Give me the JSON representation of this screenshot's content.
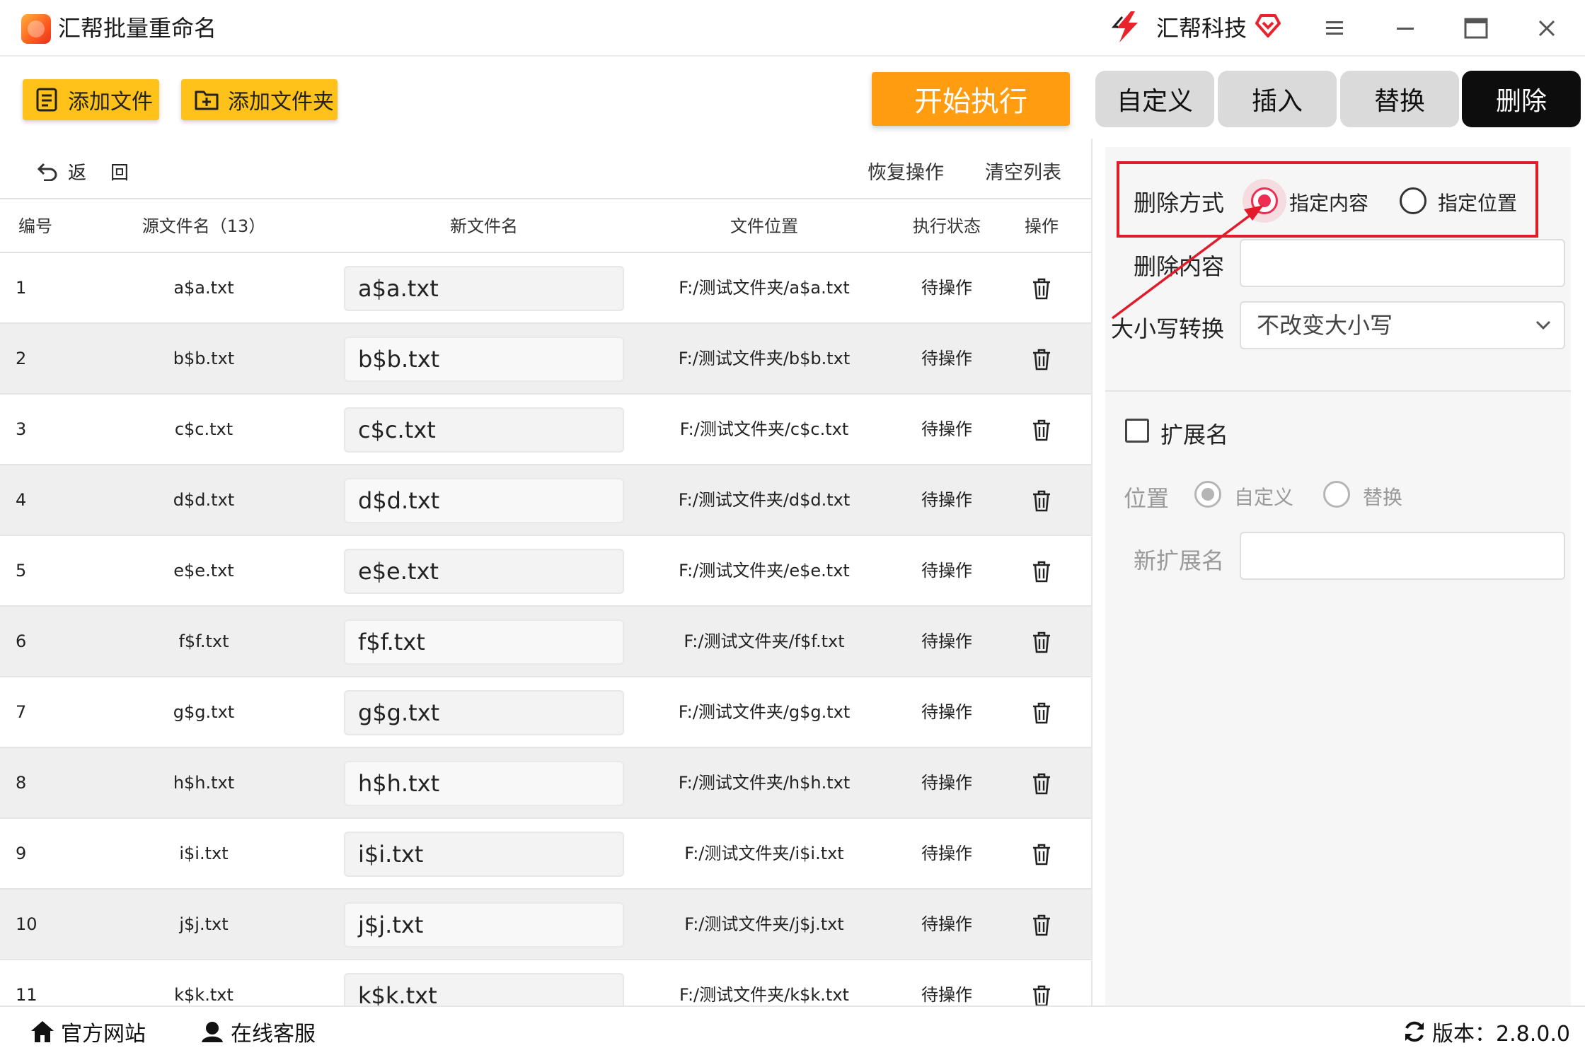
{
  "app": {
    "title": "汇帮批量重命名",
    "brand": "汇帮科技",
    "accent": "#ff9c0f",
    "highlight": "#e21b2a"
  },
  "toolbar": {
    "add_file": "添加文件",
    "add_folder": "添加文件夹",
    "start": "开始执行",
    "back": "返回",
    "restore": "恢复操作",
    "clear": "清空列表"
  },
  "tabs": [
    {
      "label": "自定义",
      "active": false
    },
    {
      "label": "插入",
      "active": false
    },
    {
      "label": "替换",
      "active": false
    },
    {
      "label": "删除",
      "active": true
    }
  ],
  "table": {
    "headers": {
      "index": "编号",
      "source": "源文件名（13）",
      "new_name": "新文件名",
      "location": "文件位置",
      "status": "执行状态",
      "action": "操作"
    },
    "rows": [
      {
        "index": "1",
        "source": "a$a.txt",
        "new_name": "a$a.txt",
        "location": "F:/测试文件夹/a$a.txt",
        "status": "待操作"
      },
      {
        "index": "2",
        "source": "b$b.txt",
        "new_name": "b$b.txt",
        "location": "F:/测试文件夹/b$b.txt",
        "status": "待操作"
      },
      {
        "index": "3",
        "source": "c$c.txt",
        "new_name": "c$c.txt",
        "location": "F:/测试文件夹/c$c.txt",
        "status": "待操作"
      },
      {
        "index": "4",
        "source": "d$d.txt",
        "new_name": "d$d.txt",
        "location": "F:/测试文件夹/d$d.txt",
        "status": "待操作"
      },
      {
        "index": "5",
        "source": "e$e.txt",
        "new_name": "e$e.txt",
        "location": "F:/测试文件夹/e$e.txt",
        "status": "待操作"
      },
      {
        "index": "6",
        "source": "f$f.txt",
        "new_name": "f$f.txt",
        "location": "F:/测试文件夹/f$f.txt",
        "status": "待操作"
      },
      {
        "index": "7",
        "source": "g$g.txt",
        "new_name": "g$g.txt",
        "location": "F:/测试文件夹/g$g.txt",
        "status": "待操作"
      },
      {
        "index": "8",
        "source": "h$h.txt",
        "new_name": "h$h.txt",
        "location": "F:/测试文件夹/h$h.txt",
        "status": "待操作"
      },
      {
        "index": "9",
        "source": "i$i.txt",
        "new_name": "i$i.txt",
        "location": "F:/测试文件夹/i$i.txt",
        "status": "待操作"
      },
      {
        "index": "10",
        "source": "j$j.txt",
        "new_name": "j$j.txt",
        "location": "F:/测试文件夹/j$j.txt",
        "status": "待操作"
      },
      {
        "index": "11",
        "source": "k$k.txt",
        "new_name": "k$k.txt",
        "location": "F:/测试文件夹/k$k.txt",
        "status": "待操作"
      }
    ]
  },
  "panel": {
    "delete_mode_label": "删除方式",
    "delete_mode_options": [
      "指定内容",
      "指定位置"
    ],
    "delete_mode_selected": "指定内容",
    "delete_content_label": "删除内容",
    "delete_content_value": "",
    "case_label": "大小写转换",
    "case_value": "不改变大小写",
    "ext_label": "扩展名",
    "ext_checked": false,
    "position_label": "位置",
    "position_options": [
      "自定义",
      "替换"
    ],
    "position_selected": "自定义",
    "new_ext_label": "新扩展名",
    "new_ext_value": ""
  },
  "statusbar": {
    "website": "官方网站",
    "support": "在线客服",
    "version": "版本：2.8.0.0"
  },
  "icons": [
    "app-logo",
    "brand-logo",
    "vip-heart-icon",
    "menu-icon",
    "minimize-icon",
    "maximize-icon",
    "close-icon",
    "document-icon",
    "folder-add-icon",
    "undo-icon",
    "trash-icon",
    "chevron-down-icon",
    "home-icon",
    "user-icon",
    "refresh-icon"
  ]
}
